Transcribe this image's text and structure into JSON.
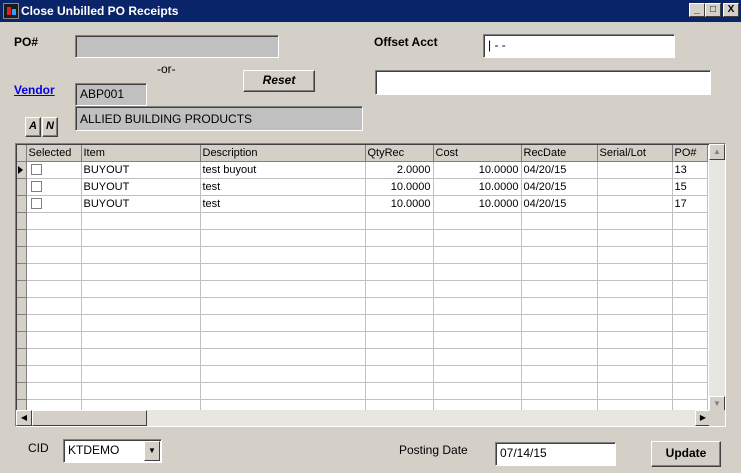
{
  "window": {
    "title": "Close Unbilled PO Receipts",
    "controls": {
      "minimize": "_",
      "maximize": "□",
      "close": "X"
    }
  },
  "form": {
    "po_label": "PO#",
    "po_value": "",
    "or_label": "-or-",
    "vendor_label": "Vendor",
    "vendor_code": "ABP001",
    "vendor_name": "ALLIED BUILDING PRODUCTS",
    "offset_label": "Offset Acct",
    "offset_value": "|   - -",
    "offset_desc": "",
    "reset_label": "Reset",
    "a_label": "A",
    "n_label": "N"
  },
  "grid": {
    "columns": [
      "Selected",
      "Item",
      "Description",
      "QtyRec",
      "Cost",
      "RecDate",
      "Serial/Lot",
      "PO#"
    ],
    "rows": [
      {
        "item": "BUYOUT",
        "description": "test buyout",
        "qty": "2.0000",
        "cost": "10.0000",
        "date": "04/20/15",
        "serial": "",
        "po": "13"
      },
      {
        "item": "BUYOUT",
        "description": "test",
        "qty": "10.0000",
        "cost": "10.0000",
        "date": "04/20/15",
        "serial": "",
        "po": "15"
      },
      {
        "item": "BUYOUT",
        "description": "test",
        "qty": "10.0000",
        "cost": "10.0000",
        "date": "04/20/15",
        "serial": "",
        "po": "17"
      }
    ]
  },
  "footer": {
    "cid_label": "CID",
    "cid_value": "KTDEMO",
    "posting_label": "Posting Date",
    "posting_value": "07/14/15",
    "update_label": "Update"
  }
}
